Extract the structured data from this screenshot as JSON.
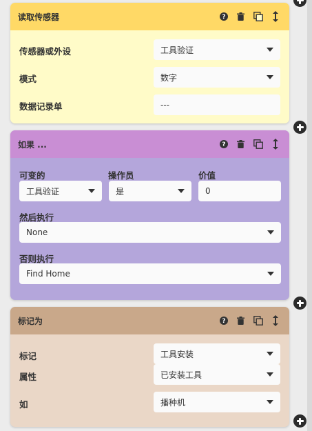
{
  "block1": {
    "title": "读取传感器",
    "rows": [
      {
        "label": "传感器或外设",
        "value": "工具验证"
      },
      {
        "label": "模式",
        "value": "数字"
      },
      {
        "label": "数据记录单",
        "value": "---"
      }
    ],
    "colors": {
      "header": "#ffd966",
      "body": "#fff9c4"
    }
  },
  "block2": {
    "title": "如果 ...",
    "col_labels": [
      "可变的",
      "操作员",
      "价值"
    ],
    "col_values": [
      "工具验证",
      "是",
      "0"
    ],
    "then_label": "然后执行",
    "then_value": "None",
    "else_label": "否则执行",
    "else_value": "Find Home",
    "colors": {
      "header": "#c98ed4",
      "body": "#b3a5d8"
    }
  },
  "block3": {
    "title": "标记为",
    "rows": [
      {
        "label": "标记",
        "value": "工具安装"
      },
      {
        "label": "属性",
        "value": "已安装工具"
      },
      {
        "label": "如",
        "value": "播种机"
      }
    ],
    "colors": {
      "header": "#c9a88a",
      "body": "#e9d6c6"
    }
  }
}
